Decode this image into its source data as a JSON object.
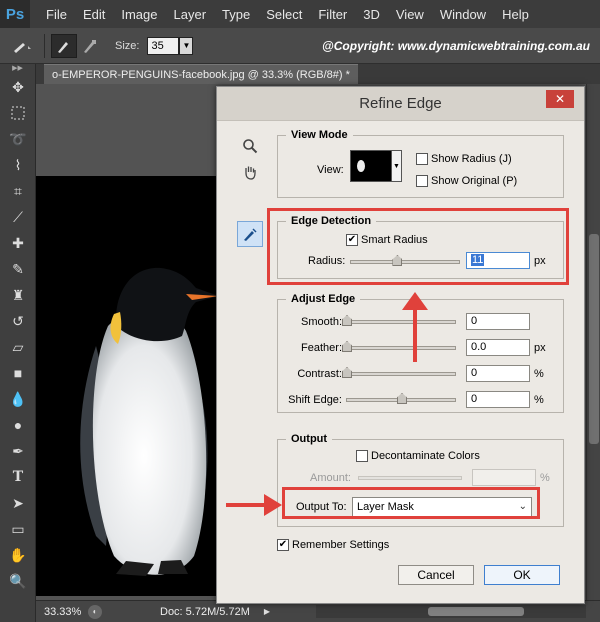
{
  "app": {
    "logo": "Ps",
    "menus": [
      "File",
      "Edit",
      "Image",
      "Layer",
      "Type",
      "Select",
      "Filter",
      "3D",
      "View",
      "Window",
      "Help"
    ]
  },
  "options": {
    "size_label": "Size:",
    "size_value": "35",
    "copyright": "@Copyright: www.dynamicwebtraining.com.au"
  },
  "document": {
    "tab_title": "o-EMPEROR-PENGUINS-facebook.jpg @ 33.3% (RGB/8#) *"
  },
  "status": {
    "zoom": "33.33%",
    "doc_info": "Doc: 5.72M/5.72M"
  },
  "dialog": {
    "title": "Refine Edge",
    "close": "✕",
    "view_mode": {
      "title": "View Mode",
      "view_label": "View:",
      "show_radius": "Show Radius (J)",
      "show_original": "Show Original (P)"
    },
    "edge_detection": {
      "title": "Edge Detection",
      "smart_radius": "Smart Radius",
      "radius_label": "Radius:",
      "radius_value": "11",
      "radius_unit": "px",
      "radius_level": 0.43
    },
    "adjust_edge": {
      "title": "Adjust Edge",
      "smooth_label": "Smooth:",
      "smooth_value": "0",
      "feather_label": "Feather:",
      "feather_value": "0.0",
      "feather_unit": "px",
      "contrast_label": "Contrast:",
      "contrast_value": "0",
      "contrast_unit": "%",
      "shift_label": "Shift Edge:",
      "shift_value": "0",
      "shift_unit": "%"
    },
    "output": {
      "title": "Output",
      "decontaminate": "Decontaminate Colors",
      "amount_label": "Amount:",
      "amount_unit": "%",
      "output_to_label": "Output To:",
      "output_to_value": "Layer Mask"
    },
    "remember": "Remember Settings",
    "cancel": "Cancel",
    "ok": "OK"
  },
  "colors": {
    "annotation": "#e0413b",
    "accent": "#3f7fcf"
  }
}
